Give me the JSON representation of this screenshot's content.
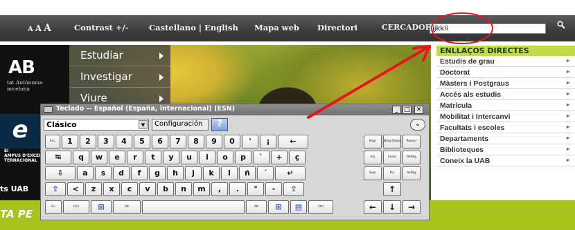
{
  "nav": {
    "text_size": [
      "A",
      "A",
      "A"
    ],
    "contrast": "Contrast +/-",
    "languages": "Castellano | English",
    "site_map": "Mapa web",
    "directory": "Directori",
    "search_label": "CERCADOR",
    "search_value": "jjkkli",
    "search_icon": "magnifier-icon"
  },
  "hero": {
    "logo": "AB",
    "logo_sub": [
      "tat Autònoma",
      "arcelona"
    ],
    "ei_text": [
      "EI",
      "AMPUS D'EXCEL·LÈ",
      "TERNACIONAL"
    ],
    "menu": [
      "Estudiar",
      "Investigar",
      "Viure"
    ],
    "fets": "ts UAB",
    "green_text": "TA PE"
  },
  "links": {
    "title": "ENLLAÇOS DIRECTES",
    "items": [
      "Estudis de grau",
      "Doctorat",
      "Màsters i Postgraus",
      "Accés als estudis",
      "Matrícula",
      "Mobilitat i Intercanvi",
      "Facultats i escoles",
      "Departaments",
      "Biblioteques",
      "Coneix la UAB"
    ],
    "arrow": "▸"
  },
  "keyboard": {
    "title": "Teclado -- Español (España, internacional) (ESN)",
    "layout": "Clásico",
    "config": "Configuración",
    "help": "?",
    "collapse": "⌄",
    "window_buttons": [
      "_",
      "□",
      "✕"
    ],
    "row1": [
      "Esc",
      "1",
      "2",
      "3",
      "4",
      "5",
      "6",
      "7",
      "8",
      "9",
      "0",
      "'",
      "¡",
      "←"
    ],
    "row2": [
      "⭾",
      "q",
      "w",
      "e",
      "r",
      "t",
      "y",
      "u",
      "i",
      "o",
      "p",
      "`",
      "+",
      "ç"
    ],
    "row3": [
      "⇩",
      "a",
      "s",
      "d",
      "f",
      "g",
      "h",
      "j",
      "k",
      "l",
      "ñ",
      "´",
      "↵"
    ],
    "row4": [
      "⇧",
      "<",
      "z",
      "x",
      "c",
      "v",
      "b",
      "n",
      "m",
      ",",
      ".",
      "°",
      "-",
      "⇧"
    ],
    "row5": [
      "Fn",
      "Ctrl",
      "⊞",
      "Alt",
      "",
      "Alt",
      "⊞",
      "▤",
      "Ctrl"
    ],
    "nav_keys": [
      "Impr",
      "Bloq Despl",
      "Pausar",
      "Ins",
      "Inicio",
      "RePág",
      "Supr",
      "Fin",
      "AvPág"
    ],
    "arrows": [
      "↑",
      "←",
      "↓",
      "→"
    ]
  }
}
